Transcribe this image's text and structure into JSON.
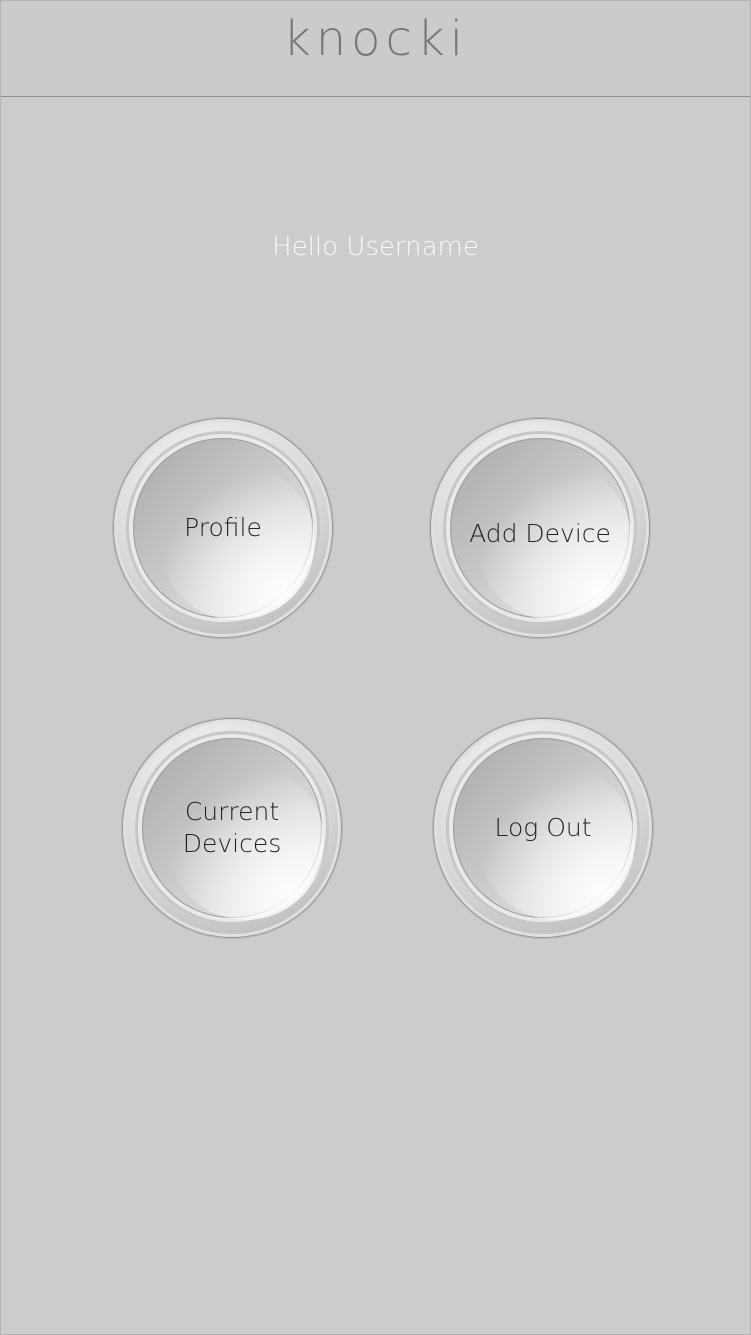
{
  "app": {
    "brand": "knocki"
  },
  "main": {
    "greeting": "Hello Username",
    "buttons": [
      {
        "label": "Profile"
      },
      {
        "label": "Add Device"
      },
      {
        "label": "Current Devices"
      },
      {
        "label": "Log Out"
      }
    ]
  },
  "colors": {
    "background": "#cccccc",
    "brand_text": "#777777",
    "greeting_text": "#f8f8f8",
    "button_text": "#222222"
  }
}
